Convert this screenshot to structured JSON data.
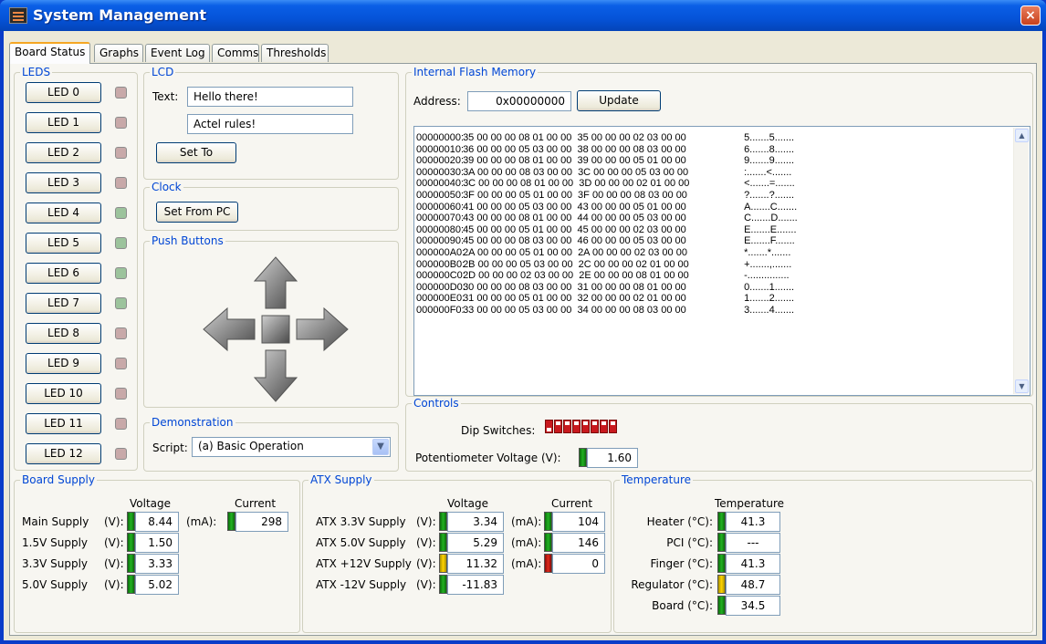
{
  "window": {
    "title": "System Management",
    "close_glyph": "×",
    "icon": "app-icon"
  },
  "tabs": [
    {
      "label": "Board Status",
      "active": true
    },
    {
      "label": "Graphs"
    },
    {
      "label": "Event Log"
    },
    {
      "label": "Comms"
    },
    {
      "label": "Thresholds"
    }
  ],
  "leds": {
    "title": "LEDS",
    "items": [
      {
        "label": "LED 0",
        "state": "off"
      },
      {
        "label": "LED 1",
        "state": "off"
      },
      {
        "label": "LED 2",
        "state": "off"
      },
      {
        "label": "LED 3",
        "state": "off"
      },
      {
        "label": "LED 4",
        "state": "on"
      },
      {
        "label": "LED 5",
        "state": "on"
      },
      {
        "label": "LED 6",
        "state": "on"
      },
      {
        "label": "LED 7",
        "state": "on"
      },
      {
        "label": "LED 8",
        "state": "off"
      },
      {
        "label": "LED 9",
        "state": "off"
      },
      {
        "label": "LED 10",
        "state": "off"
      },
      {
        "label": "LED 11",
        "state": "off"
      },
      {
        "label": "LED 12",
        "state": "off"
      }
    ],
    "colors": {
      "on": "#9cc39c",
      "off": "#c8a9a9"
    }
  },
  "lcd": {
    "title": "LCD",
    "text_label": "Text:",
    "line1": "Hello there!",
    "line2": "Actel rules!",
    "set_button": "Set To"
  },
  "clock": {
    "title": "Clock",
    "button": "Set From PC"
  },
  "push_buttons": {
    "title": "Push Buttons",
    "icons": [
      "arrow-up-icon",
      "arrow-left-icon",
      "center-square-icon",
      "arrow-right-icon",
      "arrow-down-icon"
    ]
  },
  "demonstration": {
    "title": "Demonstration",
    "script_label": "Script:",
    "script_value": "(a) Basic Operation"
  },
  "flash": {
    "title": "Internal Flash Memory",
    "address_label": "Address:",
    "address_value": "0x00000000",
    "update_button": "Update",
    "lines": [
      {
        "addr": "00000000:",
        "bytes": "35 00 00 00 08 01 00 00  35 00 00 00 02 03 00 00",
        "ascii": "5.......5......."
      },
      {
        "addr": "00000010:",
        "bytes": "36 00 00 00 05 03 00 00  38 00 00 00 08 03 00 00",
        "ascii": "6.......8......."
      },
      {
        "addr": "00000020:",
        "bytes": "39 00 00 00 08 01 00 00  39 00 00 00 05 01 00 00",
        "ascii": "9.......9......."
      },
      {
        "addr": "00000030:",
        "bytes": "3A 00 00 00 08 03 00 00  3C 00 00 00 05 03 00 00",
        "ascii": ":.......<......."
      },
      {
        "addr": "00000040:",
        "bytes": "3C 00 00 00 08 01 00 00  3D 00 00 00 02 01 00 00",
        "ascii": "<.......=......."
      },
      {
        "addr": "00000050:",
        "bytes": "3F 00 00 00 05 01 00 00  3F 00 00 00 08 03 00 00",
        "ascii": "?.......?......."
      },
      {
        "addr": "00000060:",
        "bytes": "41 00 00 00 05 03 00 00  43 00 00 00 05 01 00 00",
        "ascii": "A.......C......."
      },
      {
        "addr": "00000070:",
        "bytes": "43 00 00 00 08 01 00 00  44 00 00 00 05 03 00 00",
        "ascii": "C.......D......."
      },
      {
        "addr": "00000080:",
        "bytes": "45 00 00 00 05 01 00 00  45 00 00 00 02 03 00 00",
        "ascii": "E.......E......."
      },
      {
        "addr": "00000090:",
        "bytes": "45 00 00 00 08 03 00 00  46 00 00 00 05 03 00 00",
        "ascii": "E.......F......."
      },
      {
        "addr": "000000A0:",
        "bytes": "2A 00 00 00 05 01 00 00  2A 00 00 00 02 03 00 00",
        "ascii": "*.......*......."
      },
      {
        "addr": "000000B0:",
        "bytes": "2B 00 00 00 05 03 00 00  2C 00 00 00 02 01 00 00",
        "ascii": "+.......,......."
      },
      {
        "addr": "000000C0:",
        "bytes": "2D 00 00 00 02 03 00 00  2E 00 00 00 08 01 00 00",
        "ascii": "-..............."
      },
      {
        "addr": "000000D0:",
        "bytes": "30 00 00 00 08 03 00 00  31 00 00 00 08 01 00 00",
        "ascii": "0.......1......."
      },
      {
        "addr": "000000E0:",
        "bytes": "31 00 00 00 05 01 00 00  32 00 00 00 02 01 00 00",
        "ascii": "1.......2......."
      },
      {
        "addr": "000000F0:",
        "bytes": "33 00 00 00 05 03 00 00  34 00 00 00 08 03 00 00",
        "ascii": "3.......4......."
      }
    ],
    "scroll_up": "▲",
    "scroll_down": "▼"
  },
  "controls": {
    "title": "Controls",
    "dip_label": "Dip Switches:",
    "dip_switches": [
      "down",
      "up",
      "up",
      "up",
      "up",
      "up",
      "up",
      "up"
    ],
    "pot_label": "Potentiometer Voltage (V):",
    "pot_value": "1.60",
    "pot_status": "green"
  },
  "board_supply": {
    "title": "Board Supply",
    "voltage_header": "Voltage",
    "current_header": "Current",
    "rows": [
      {
        "label": "Main Supply",
        "unit": "(V):",
        "value": "8.44"
      },
      {
        "label": "1.5V Supply",
        "unit": "(V):",
        "value": "1.50"
      },
      {
        "label": "3.3V Supply",
        "unit": "(V):",
        "value": "3.33"
      },
      {
        "label": "5.0V Supply",
        "unit": "(V):",
        "value": "5.02"
      }
    ],
    "current_unit": "(mA):",
    "current_value": "298",
    "current_status": "green"
  },
  "atx_supply": {
    "title": "ATX Supply",
    "voltage_header": "Voltage",
    "current_header": "Current",
    "rows": [
      {
        "label": "ATX 3.3V Supply",
        "unit": "(V):",
        "value": "3.34",
        "v_status": "green",
        "c_unit": "(mA):",
        "current": "104",
        "c_status": "green"
      },
      {
        "label": "ATX 5.0V Supply",
        "unit": "(V):",
        "value": "5.29",
        "v_status": "green",
        "c_unit": "(mA):",
        "current": "146",
        "c_status": "green"
      },
      {
        "label": "ATX +12V Supply",
        "unit": "(V):",
        "value": "11.32",
        "v_status": "yellow",
        "c_unit": "(mA):",
        "current": "0",
        "c_status": "red"
      },
      {
        "label": "ATX -12V Supply",
        "unit": "(V):",
        "value": "-11.83",
        "v_status": "green"
      }
    ]
  },
  "temperature": {
    "title": "Temperature",
    "header": "Temperature",
    "rows": [
      {
        "label": "Heater (°C):",
        "value": "41.3",
        "status": "green"
      },
      {
        "label": "PCI (°C):",
        "value": "---",
        "status": "green"
      },
      {
        "label": "Finger (°C):",
        "value": "41.3",
        "status": "green"
      },
      {
        "label": "Regulator (°C):",
        "value": "48.7",
        "status": "yellow"
      },
      {
        "label": "Board (°C):",
        "value": "34.5",
        "status": "green"
      }
    ]
  }
}
